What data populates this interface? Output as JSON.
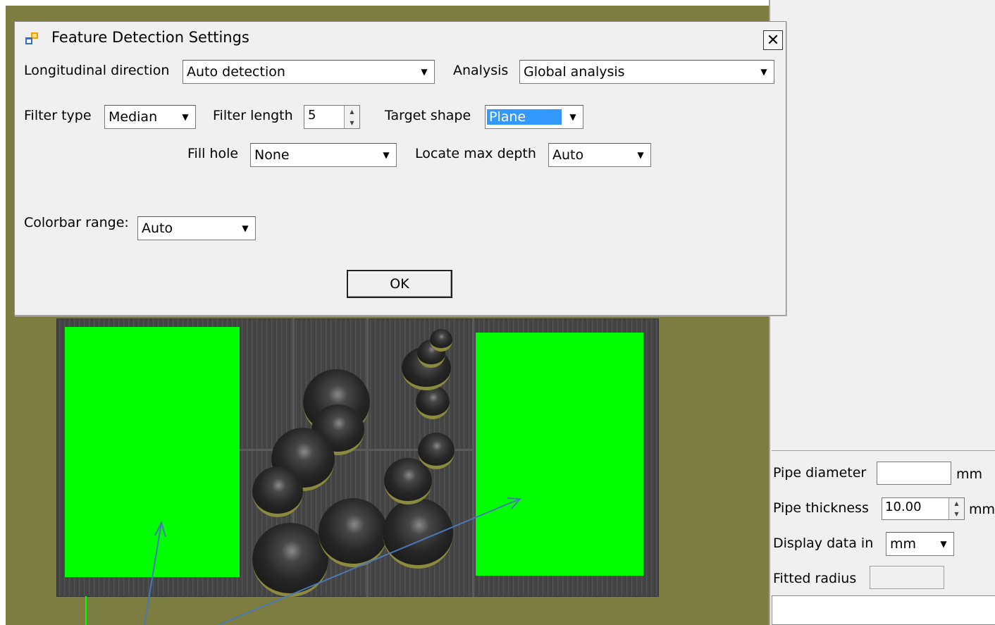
{
  "dialog": {
    "title": "Feature Detection Settings",
    "close_glyph": "✕",
    "longitudinal_label": "Longitudinal direction",
    "longitudinal_value": "Auto detection",
    "analysis_label": "Analysis",
    "analysis_value": "Global analysis",
    "filter_type_label": "Filter type",
    "filter_type_value": "Median",
    "filter_length_label": "Filter length",
    "filter_length_value": "5",
    "target_shape_label": "Target shape",
    "target_shape_value": "Plane",
    "fill_hole_label": "Fill hole",
    "fill_hole_value": "None",
    "locate_max_depth_label": "Locate max depth",
    "locate_max_depth_value": "Auto",
    "colorbar_range_label": "Colorbar range:",
    "colorbar_range_value": "Auto",
    "ok_label": "OK"
  },
  "right_panel": {
    "pipe_diameter_label": "Pipe diameter",
    "pipe_diameter_value": "",
    "pipe_diameter_unit": "mm",
    "pipe_thickness_label": "Pipe thickness",
    "pipe_thickness_value": "10.00",
    "pipe_thickness_unit": "mm",
    "display_data_label": "Display data in",
    "display_data_value": "mm",
    "fitted_radius_label": "Fitted radius",
    "fitted_radius_value": ""
  },
  "colors": {
    "canvas_bg": "#7e7d41",
    "highlight": "#00ff00",
    "selection": "#3399ff",
    "arrow": "#4a78b8"
  },
  "icons": {
    "app": "app-window-icon",
    "dropdown": "chevron-down-icon"
  }
}
